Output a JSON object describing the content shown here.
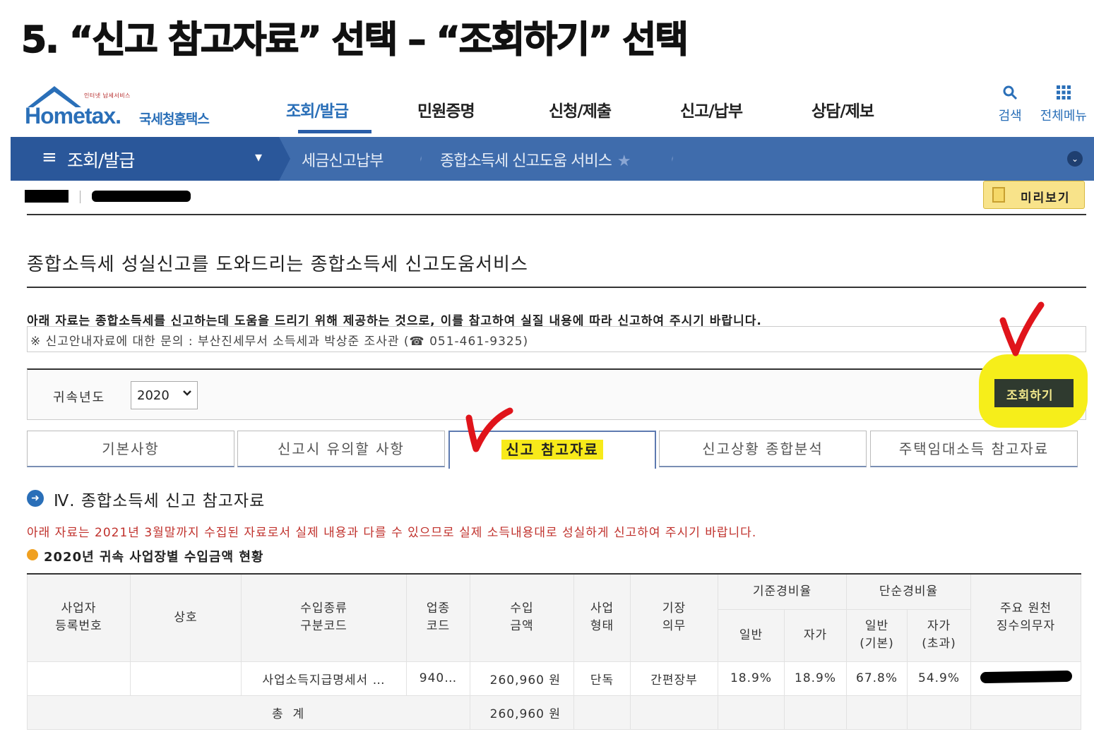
{
  "caption": "5. “신고 참고자료” 선택 – “조회하기” 선택",
  "logo": {
    "small": "인터넷 납세서비스",
    "brand": "Hometax.",
    "brand_kr": "국세청홈택스"
  },
  "main_menu": [
    "조회/발급",
    "민원증명",
    "신청/제출",
    "신고/납부",
    "상담/제보"
  ],
  "tools": [
    {
      "label": "검색",
      "icon": "search-icon"
    },
    {
      "label": "전체메뉴",
      "icon": "grid-menu-icon"
    }
  ],
  "breadcrumb": {
    "first": "조회/발급",
    "second": "세금신고납부",
    "third": "종합소득세 신고도움 서비스"
  },
  "preview_label": "미리보기",
  "page_heading": "종합소득세 성실신고를 도와드리는 종합소득세 신고도움서비스",
  "notice": "아래 자료는 종합소득세를 신고하는데 도움을 드리기 위해 제공하는 것으로, 이를 참고하여 실질 내용에 따라 신고하여 주시기 바랍니다.",
  "inquiry": "※ 신고안내자료에 대한 문의 : 부산진세무서 소득세과 박상준 조사관 (☎ 051-461-9325)",
  "search": {
    "year_label": "귀속년도",
    "year_value": "2020",
    "button": "조회하기"
  },
  "tabs": [
    "기본사항",
    "신고시 유의할 사항",
    "신고 참고자료",
    "신고상황 종합분석",
    "주택임대소득 참고자료"
  ],
  "section": {
    "title": "Ⅳ. 종합소득세 신고 참고자료",
    "red_note": "아래 자료는 2021년 3월말까지 수집된 자료로서 실제 내용과 다를 수 있으므로 실제 소득내용대로 성실하게 신고하여 주시기 바랍니다.",
    "sub_title": "2020년 귀속 사업장별 수입금액 현황"
  },
  "table": {
    "headers": {
      "biz_no": "사업자\n등록번호",
      "name": "상호",
      "income_type": "수입종류\n구분코드",
      "industry": "업종\n코드",
      "revenue": "수입\n금액",
      "biz_form": "사업\n형태",
      "bookkeeping": "기장\n의무",
      "std_rate": "기준경비율",
      "std_general": "일반",
      "std_self": "자가",
      "simple_rate": "단순경비율",
      "simple_general": "일반\n(기본)",
      "simple_self": "자가\n(초과)",
      "withholder": "주요 원천\n징수의무자"
    },
    "row": {
      "biz_no": "",
      "name": "",
      "income_type": "사업소득지급명세서 …",
      "industry": "940…",
      "revenue": "260,960 원",
      "biz_form": "단독",
      "bookkeeping": "간편장부",
      "std_general": "18.9%",
      "std_self": "18.9%",
      "simple_general": "67.8%",
      "simple_self": "54.9%"
    },
    "total": {
      "label": "총  계",
      "revenue": "260,960 원"
    }
  },
  "colors": {
    "brand_blue": "#2a6fb8",
    "breadcrumb_bar": "#3f6cac",
    "highlight_yellow": "#f6ee1a",
    "check_red": "#e0141b",
    "note_red": "#c0312c"
  }
}
